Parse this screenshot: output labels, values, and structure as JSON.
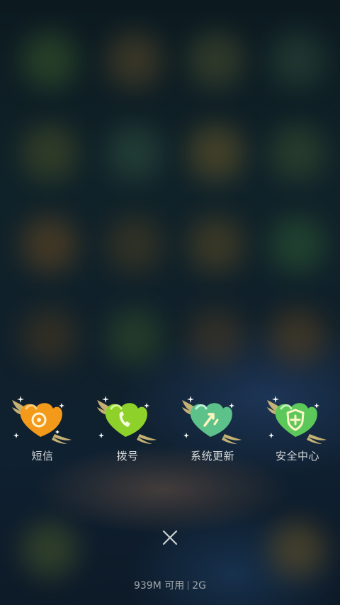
{
  "apps": [
    {
      "label": "短信",
      "icon": "message-heart-icon",
      "color": "#f39a1a"
    },
    {
      "label": "拨号",
      "icon": "phone-heart-icon",
      "color": "#8ed12a"
    },
    {
      "label": "系统更新",
      "icon": "update-heart-icon",
      "color": "#5cc28a"
    },
    {
      "label": "安全中心",
      "icon": "shield-heart-icon",
      "color": "#5cc85a"
    }
  ],
  "status": {
    "memory": "939M 可用",
    "network": "2G"
  },
  "close": {
    "icon": "close-icon"
  }
}
